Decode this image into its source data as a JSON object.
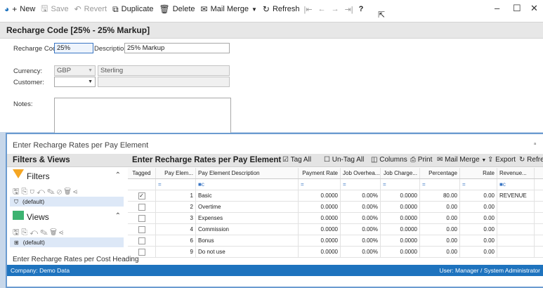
{
  "toolbar": {
    "new_label": "New",
    "save_label": "Save",
    "revert_label": "Revert",
    "duplicate_label": "Duplicate",
    "delete_label": "Delete",
    "mail_merge_label": "Mail Merge",
    "refresh_label": "Refresh",
    "help_label": "?"
  },
  "window": {
    "minimize": "–",
    "maximize": "☐",
    "close": "✕"
  },
  "record_title": "Recharge Code [25% - 25% Markup]",
  "form": {
    "recharge_code_label": "Recharge Code:",
    "recharge_code_value": "25%",
    "description_label": "Description:",
    "description_value": "25% Markup",
    "currency_label": "Currency:",
    "currency_value": "GBP",
    "currency_name": "Sterling",
    "customer_label": "Customer:",
    "customer_value": "",
    "notes_label": "Notes:",
    "notes_value": ""
  },
  "panel": {
    "title": "Enter Recharge Rates per Pay Element",
    "pin": "ᵃ",
    "bottom_title": "Enter Recharge Rates per Cost Heading"
  },
  "left_panel": {
    "header": "Filters & Views",
    "filters_title": "Filters",
    "filters_default": "(default)",
    "views_title": "Views",
    "views_default": "(default)"
  },
  "grid_panel": {
    "title": "Enter Recharge Rates per Pay Element",
    "tag_all": "Tag All",
    "untag_all": "Un-Tag All",
    "columns": "Columns",
    "print": "Print",
    "mail_merge": "Mail Merge",
    "export": "Export",
    "refresh": "Refresh"
  },
  "grid": {
    "headers": [
      "Tagged",
      "Pay Elem...",
      "Pay Element Description",
      "Payment Rate",
      "Job Overhea...",
      "Job Charge...",
      "Percentage",
      "Rate",
      "Revenue..."
    ],
    "filter_row": [
      "",
      "=",
      "■c",
      "=",
      "=",
      "=",
      "=",
      "=",
      "■c"
    ],
    "rows": [
      {
        "tagged": true,
        "code": "1",
        "desc": "Basic",
        "payment_rate": "0.0000",
        "overhead": "0.00%",
        "charge": "0.0000",
        "percentage": "80.00",
        "rate": "0.00",
        "revenue": "REVENUE"
      },
      {
        "tagged": false,
        "code": "2",
        "desc": "Overtime",
        "payment_rate": "0.0000",
        "overhead": "0.00%",
        "charge": "0.0000",
        "percentage": "0.00",
        "rate": "0.00",
        "revenue": ""
      },
      {
        "tagged": false,
        "code": "3",
        "desc": "Expenses",
        "payment_rate": "0.0000",
        "overhead": "0.00%",
        "charge": "0.0000",
        "percentage": "0.00",
        "rate": "0.00",
        "revenue": ""
      },
      {
        "tagged": false,
        "code": "4",
        "desc": "Commission",
        "payment_rate": "0.0000",
        "overhead": "0.00%",
        "charge": "0.0000",
        "percentage": "0.00",
        "rate": "0.00",
        "revenue": ""
      },
      {
        "tagged": false,
        "code": "6",
        "desc": "Bonus",
        "payment_rate": "0.0000",
        "overhead": "0.00%",
        "charge": "0.0000",
        "percentage": "0.00",
        "rate": "0.00",
        "revenue": ""
      },
      {
        "tagged": false,
        "code": "9",
        "desc": "Do not use",
        "payment_rate": "0.0000",
        "overhead": "0.00%",
        "charge": "0.0000",
        "percentage": "0.00",
        "rate": "0.00",
        "revenue": ""
      }
    ]
  },
  "status": {
    "company": "Company: Demo Data",
    "user": "User: Manager / System Administrator"
  },
  "colors": {
    "accent": "#1e73be",
    "filters": "#f5a623",
    "views": "#3cb371"
  }
}
